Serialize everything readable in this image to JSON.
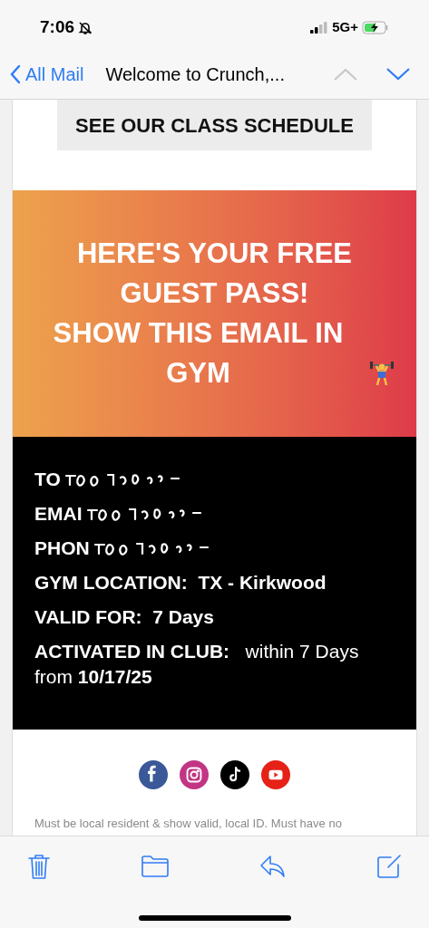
{
  "status_bar": {
    "time": "7:06",
    "network": "5G+"
  },
  "nav_bar": {
    "back_label": "All Mail",
    "title": "Welcome to Crunch,...",
    "prev_disabled": true,
    "next_disabled": false
  },
  "email": {
    "schedule_button": "SEE OUR CLASS SCHEDULE",
    "banner": {
      "lines": [
        "HERE'S YOUR FREE GUEST PASS!",
        "SHOW THIS EMAIL IN GYM"
      ]
    },
    "pass_details": [
      {
        "kind": "redacted",
        "label": "TO"
      },
      {
        "kind": "redacted",
        "label": "EMAI"
      },
      {
        "kind": "redacted",
        "label": "PHON"
      },
      {
        "kind": "text",
        "text": "**GYM LOCATION:  TX - Kirkwood**"
      },
      {
        "kind": "text",
        "text": "**VALID FOR:  7 Days**"
      },
      {
        "kind": "text",
        "text": "**ACTIVATED IN CLUB:**   within 7 Days from **10/17/25**"
      }
    ],
    "social_links": [
      {
        "kind": "facebook",
        "color": "#3b5998"
      },
      {
        "kind": "instagram",
        "color": "#c13584"
      },
      {
        "kind": "tiktok",
        "color": "#000000"
      },
      {
        "kind": "youtube",
        "color": "#e62117"
      }
    ],
    "footer_text": "Must be local resident & show valid, local ID. Must have no"
  },
  "toolbar": [
    {
      "kind": "trash"
    },
    {
      "kind": "folder"
    },
    {
      "kind": "reply"
    },
    {
      "kind": "compose"
    }
  ]
}
